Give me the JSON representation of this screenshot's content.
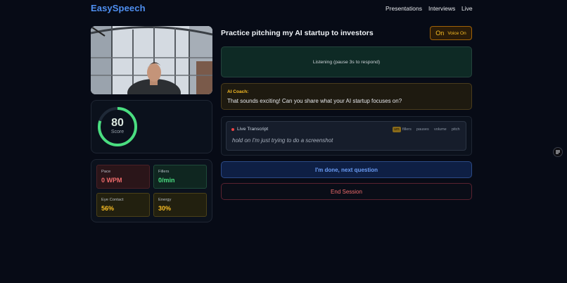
{
  "brand": "EasySpeech",
  "nav": [
    "Presentations",
    "Interviews",
    "Live"
  ],
  "colors": {
    "accent": "#4f8ff0",
    "success": "#4ade80",
    "warning": "#fbbf24",
    "danger": "#ef6b6b"
  },
  "score": {
    "value": "80",
    "label": "Score",
    "fraction": 0.8
  },
  "metrics": [
    {
      "label": "Pace",
      "value": "0 WPM"
    },
    {
      "label": "Fillers",
      "value": "0/min"
    },
    {
      "label": "Eye Contact",
      "value": "56%"
    },
    {
      "label": "Energy",
      "value": "30%"
    }
  ],
  "session": {
    "title": "Practice pitching my AI startup to investors",
    "voice_state": "On",
    "voice_label": "Voice On",
    "listening": "Listening (pause 3s to respond)"
  },
  "coach": {
    "heading": "AI Coach:",
    "message": "That sounds exciting! Can you share what your AI startup focuses on?"
  },
  "transcript": {
    "heading": "Live Transcript",
    "tags": [
      "um",
      "fillers",
      "pauses",
      "volume",
      "pitch"
    ],
    "text": "hold on I'm just trying to do a screenshot"
  },
  "actions": {
    "next": "I'm done, next question",
    "end": "End Session"
  }
}
